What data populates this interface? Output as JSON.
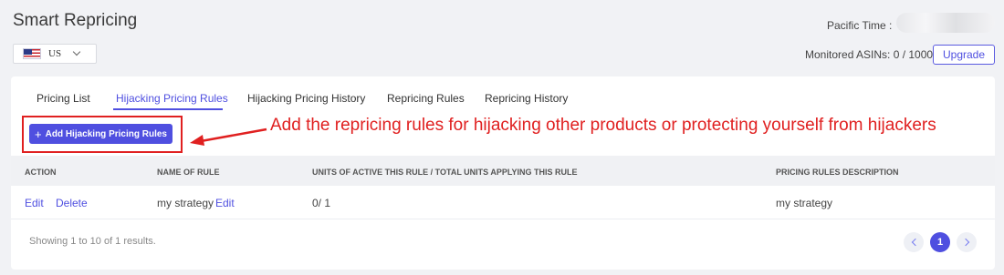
{
  "header": {
    "title": "Smart Repricing",
    "country": {
      "code": "US",
      "flag_icon": "us-flag-icon"
    },
    "pacific_time_label": "Pacific Time :",
    "monitored_asins": "Monitored ASINs: 0 / 1000",
    "upgrade_label": "Upgrade"
  },
  "tabs": [
    {
      "label": "Pricing List",
      "active": false
    },
    {
      "label": "Hijacking Pricing Rules",
      "active": true
    },
    {
      "label": "Hijacking Pricing History",
      "active": false
    },
    {
      "label": "Repricing Rules",
      "active": false
    },
    {
      "label": "Repricing History",
      "active": false
    }
  ],
  "toolbar": {
    "add_button_label": "Add Hijacking Pricing Rules",
    "add_icon": "plus-icon"
  },
  "annotation": {
    "text": "Add the repricing rules for hijacking other products or protecting yourself from hijackers",
    "color": "#e02020"
  },
  "table": {
    "columns": [
      "ACTION",
      "NAME OF RULE",
      "UNITS OF ACTIVE THIS RULE / TOTAL UNITS APPLYING THIS RULE",
      "PRICING RULES DESCRIPTION"
    ],
    "rows": [
      {
        "edit_label": "Edit",
        "delete_label": "Delete",
        "name": "my strategy",
        "name_edit_label": "Edit",
        "units": "0/ 1",
        "description": "my strategy"
      }
    ]
  },
  "footer": {
    "showing": "Showing 1 to 10 of 1 results.",
    "current_page": "1"
  },
  "colors": {
    "accent": "#4f4fe0",
    "annotation_red": "#e02020",
    "background": "#f1f2f5"
  }
}
